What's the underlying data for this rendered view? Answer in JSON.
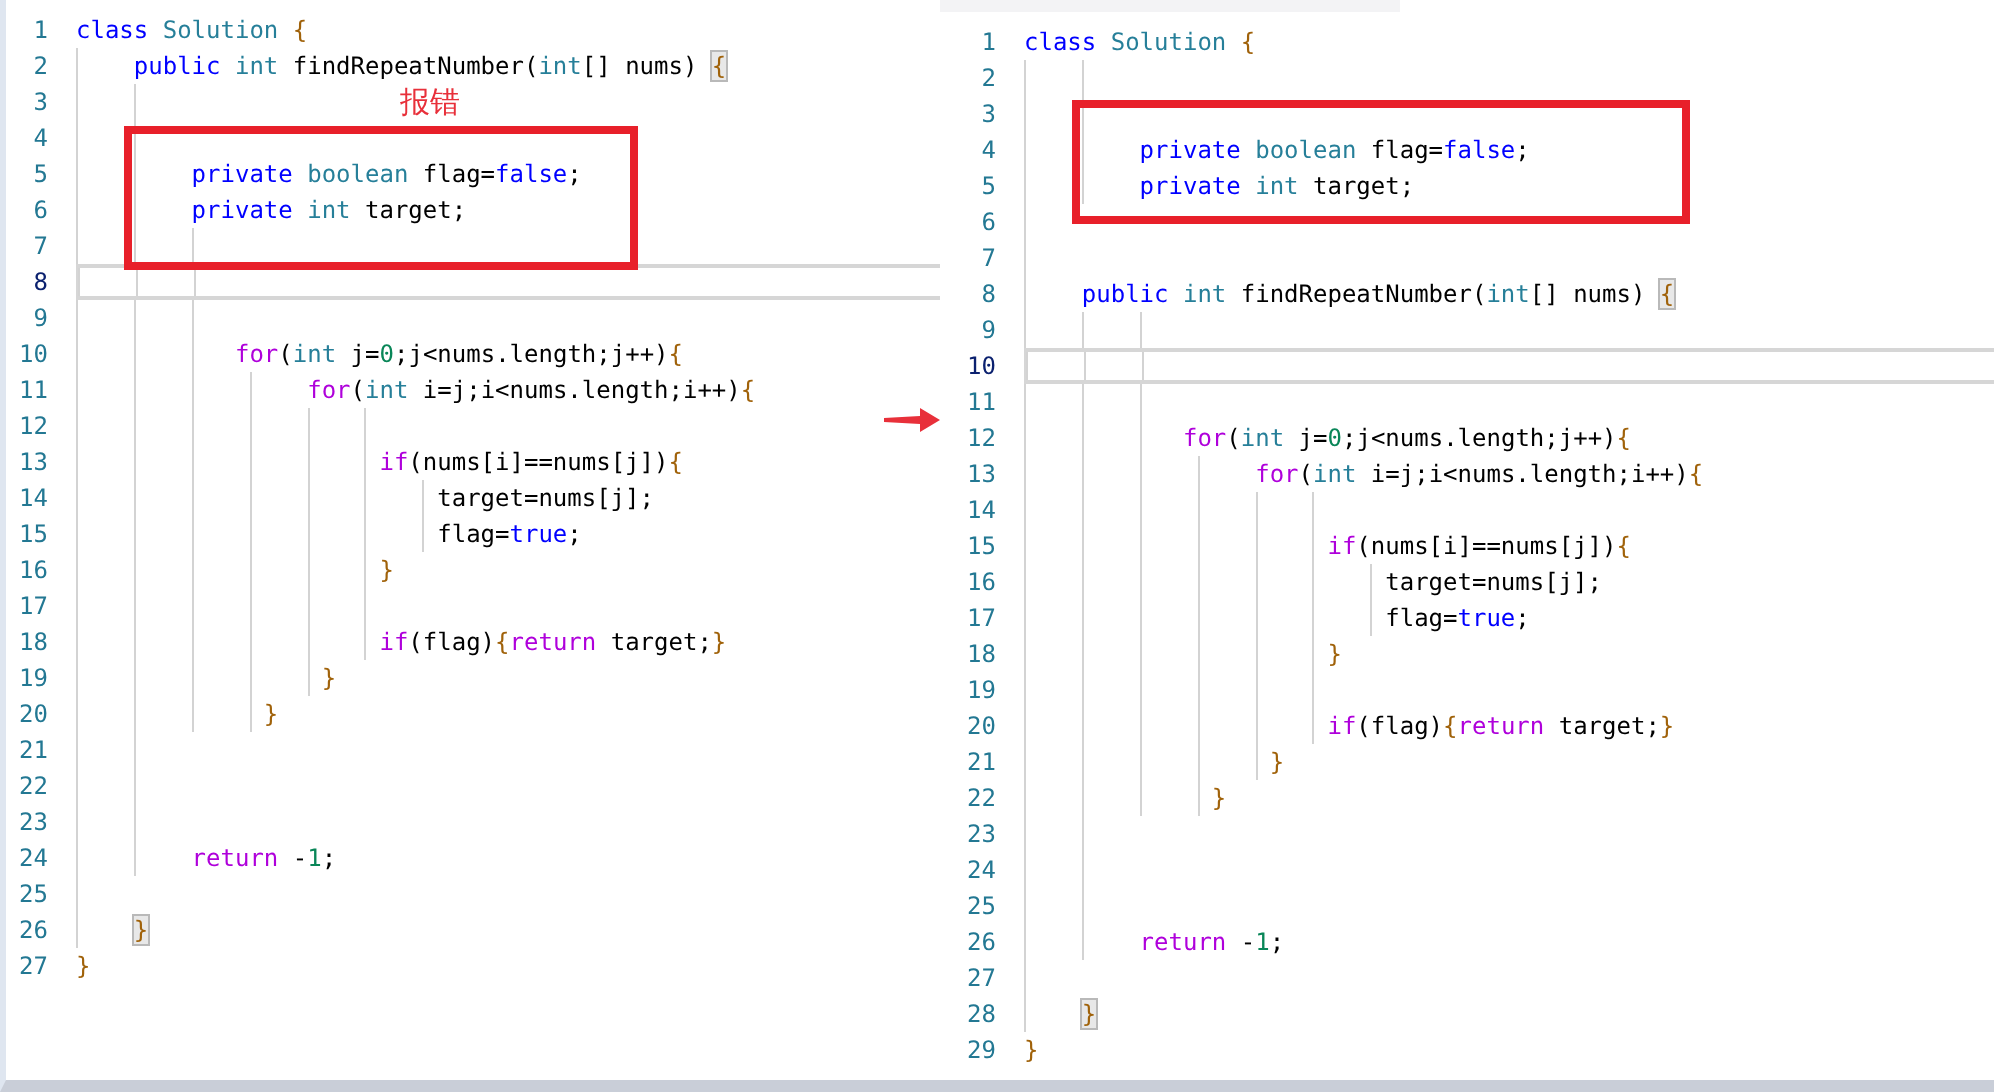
{
  "panes": [
    {
      "box_label": "报错",
      "lines": [
        {
          "number": "1",
          "current": false,
          "boxed": false,
          "tokens": [
            {
              "kind": "kw",
              "text": "class"
            },
            {
              "kind": "type",
              "text": " Solution"
            },
            {
              "kind": "brace",
              "text": " {"
            }
          ]
        },
        {
          "number": "2",
          "current": false,
          "boxed": false,
          "tokens": [
            {
              "kind": "kw",
              "text": "    public"
            },
            {
              "kind": "type",
              "text": " int"
            },
            {
              "kind": "txt",
              "text": " findRepeatNumber("
            },
            {
              "kind": "type",
              "text": "int"
            },
            {
              "kind": "txt",
              "text": "[] nums) "
            },
            {
              "kind": "match",
              "text": "{"
            }
          ]
        },
        {
          "number": "3",
          "current": false,
          "boxed": false
        },
        {
          "number": "4",
          "current": false,
          "boxed": true
        },
        {
          "number": "5",
          "current": false,
          "boxed": true,
          "tokens": [
            {
              "kind": "kw",
              "text": "        private"
            },
            {
              "kind": "type",
              "text": " boolean"
            },
            {
              "kind": "txt",
              "text": " flag="
            },
            {
              "kind": "kw",
              "text": "false"
            },
            {
              "kind": "txt",
              "text": ";"
            }
          ]
        },
        {
          "number": "6",
          "current": false,
          "boxed": true,
          "tokens": [
            {
              "kind": "kw",
              "text": "        private"
            },
            {
              "kind": "type",
              "text": " int"
            },
            {
              "kind": "txt",
              "text": " target;"
            }
          ]
        },
        {
          "number": "7",
          "current": false,
          "boxed": true
        },
        {
          "number": "8",
          "current": true,
          "boxed": false
        },
        {
          "number": "9",
          "current": false,
          "boxed": false
        },
        {
          "number": "10",
          "current": false,
          "boxed": false,
          "tokens": [
            {
              "kind": "ctl",
              "text": "           for"
            },
            {
              "kind": "txt",
              "text": "("
            },
            {
              "kind": "type",
              "text": "int"
            },
            {
              "kind": "txt",
              "text": " j="
            },
            {
              "kind": "num",
              "text": "0"
            },
            {
              "kind": "txt",
              "text": ";j<nums.length;j++)"
            },
            {
              "kind": "brace",
              "text": "{"
            }
          ]
        },
        {
          "number": "11",
          "current": false,
          "boxed": false,
          "tokens": [
            {
              "kind": "ctl",
              "text": "                for"
            },
            {
              "kind": "txt",
              "text": "("
            },
            {
              "kind": "type",
              "text": "int"
            },
            {
              "kind": "txt",
              "text": " i=j;i<nums.length;i++)"
            },
            {
              "kind": "brace",
              "text": "{"
            }
          ]
        },
        {
          "number": "12",
          "current": false,
          "boxed": false
        },
        {
          "number": "13",
          "current": false,
          "boxed": false,
          "tokens": [
            {
              "kind": "ctl",
              "text": "                     if"
            },
            {
              "kind": "txt",
              "text": "(nums[i]==nums[j])"
            },
            {
              "kind": "brace",
              "text": "{"
            }
          ]
        },
        {
          "number": "14",
          "current": false,
          "boxed": false,
          "tokens": [
            {
              "kind": "txt",
              "text": "                         target=nums[j];"
            }
          ]
        },
        {
          "number": "15",
          "current": false,
          "boxed": false,
          "tokens": [
            {
              "kind": "txt",
              "text": "                         flag="
            },
            {
              "kind": "kw",
              "text": "true"
            },
            {
              "kind": "txt",
              "text": ";"
            }
          ]
        },
        {
          "number": "16",
          "current": false,
          "boxed": false,
          "tokens": [
            {
              "kind": "brace",
              "text": "                     }"
            }
          ]
        },
        {
          "number": "17",
          "current": false,
          "boxed": false
        },
        {
          "number": "18",
          "current": false,
          "boxed": false,
          "tokens": [
            {
              "kind": "ctl",
              "text": "                     if"
            },
            {
              "kind": "txt",
              "text": "(flag)"
            },
            {
              "kind": "brace",
              "text": "{"
            },
            {
              "kind": "ctl",
              "text": "return"
            },
            {
              "kind": "txt",
              "text": " target;"
            },
            {
              "kind": "brace",
              "text": "}"
            }
          ]
        },
        {
          "number": "19",
          "current": false,
          "boxed": false,
          "tokens": [
            {
              "kind": "brace",
              "text": "                 }"
            }
          ]
        },
        {
          "number": "20",
          "current": false,
          "boxed": false,
          "tokens": [
            {
              "kind": "brace",
              "text": "             }"
            }
          ]
        },
        {
          "number": "21",
          "current": false,
          "boxed": false
        },
        {
          "number": "22",
          "current": false,
          "boxed": false
        },
        {
          "number": "23",
          "current": false,
          "boxed": false
        },
        {
          "number": "24",
          "current": false,
          "boxed": false,
          "tokens": [
            {
              "kind": "ctl",
              "text": "        return"
            },
            {
              "kind": "txt",
              "text": " -"
            },
            {
              "kind": "num",
              "text": "1"
            },
            {
              "kind": "txt",
              "text": ";"
            }
          ]
        },
        {
          "number": "25",
          "current": false,
          "boxed": false
        },
        {
          "number": "26",
          "current": false,
          "boxed": false,
          "tokens": [
            {
              "kind": "match",
              "text": "    }"
            }
          ]
        },
        {
          "number": "27",
          "current": false,
          "boxed": false,
          "tokens": [
            {
              "kind": "brace",
              "text": "}"
            }
          ]
        }
      ]
    },
    {
      "lines": [
        {
          "number": "1",
          "current": false,
          "boxed": false,
          "tokens": [
            {
              "kind": "kw",
              "text": "class"
            },
            {
              "kind": "type",
              "text": " Solution"
            },
            {
              "kind": "brace",
              "text": " {"
            }
          ]
        },
        {
          "number": "2",
          "current": false,
          "boxed": false
        },
        {
          "number": "3",
          "current": false,
          "boxed": true
        },
        {
          "number": "4",
          "current": false,
          "boxed": true,
          "tokens": [
            {
              "kind": "kw",
              "text": "        private"
            },
            {
              "kind": "type",
              "text": " boolean"
            },
            {
              "kind": "txt",
              "text": " flag="
            },
            {
              "kind": "kw",
              "text": "false"
            },
            {
              "kind": "txt",
              "text": ";"
            }
          ]
        },
        {
          "number": "5",
          "current": false,
          "boxed": true,
          "tokens": [
            {
              "kind": "kw",
              "text": "        private"
            },
            {
              "kind": "type",
              "text": " int"
            },
            {
              "kind": "txt",
              "text": " target;"
            }
          ]
        },
        {
          "number": "6",
          "current": false,
          "boxed": true
        },
        {
          "number": "7",
          "current": false,
          "boxed": false
        },
        {
          "number": "8",
          "current": false,
          "boxed": false,
          "tokens": [
            {
              "kind": "kw",
              "text": "    public"
            },
            {
              "kind": "type",
              "text": " int"
            },
            {
              "kind": "txt",
              "text": " findRepeatNumber("
            },
            {
              "kind": "type",
              "text": "int"
            },
            {
              "kind": "txt",
              "text": "[] nums) "
            },
            {
              "kind": "match",
              "text": "{"
            }
          ]
        },
        {
          "number": "9",
          "current": false,
          "boxed": false
        },
        {
          "number": "10",
          "current": true,
          "boxed": false
        },
        {
          "number": "11",
          "current": false,
          "boxed": false
        },
        {
          "number": "12",
          "current": false,
          "boxed": false,
          "tokens": [
            {
              "kind": "ctl",
              "text": "           for"
            },
            {
              "kind": "txt",
              "text": "("
            },
            {
              "kind": "type",
              "text": "int"
            },
            {
              "kind": "txt",
              "text": " j="
            },
            {
              "kind": "num",
              "text": "0"
            },
            {
              "kind": "txt",
              "text": ";j<nums.length;j++)"
            },
            {
              "kind": "brace",
              "text": "{"
            }
          ]
        },
        {
          "number": "13",
          "current": false,
          "boxed": false,
          "tokens": [
            {
              "kind": "ctl",
              "text": "                for"
            },
            {
              "kind": "txt",
              "text": "("
            },
            {
              "kind": "type",
              "text": "int"
            },
            {
              "kind": "txt",
              "text": " i=j;i<nums.length;i++)"
            },
            {
              "kind": "brace",
              "text": "{"
            }
          ]
        },
        {
          "number": "14",
          "current": false,
          "boxed": false
        },
        {
          "number": "15",
          "current": false,
          "boxed": false,
          "tokens": [
            {
              "kind": "ctl",
              "text": "                     if"
            },
            {
              "kind": "txt",
              "text": "(nums[i]==nums[j])"
            },
            {
              "kind": "brace",
              "text": "{"
            }
          ]
        },
        {
          "number": "16",
          "current": false,
          "boxed": false,
          "tokens": [
            {
              "kind": "txt",
              "text": "                         target=nums[j];"
            }
          ]
        },
        {
          "number": "17",
          "current": false,
          "boxed": false,
          "tokens": [
            {
              "kind": "txt",
              "text": "                         flag="
            },
            {
              "kind": "kw",
              "text": "true"
            },
            {
              "kind": "txt",
              "text": ";"
            }
          ]
        },
        {
          "number": "18",
          "current": false,
          "boxed": false,
          "tokens": [
            {
              "kind": "brace",
              "text": "                     }"
            }
          ]
        },
        {
          "number": "19",
          "current": false,
          "boxed": false
        },
        {
          "number": "20",
          "current": false,
          "boxed": false,
          "tokens": [
            {
              "kind": "ctl",
              "text": "                     if"
            },
            {
              "kind": "txt",
              "text": "(flag)"
            },
            {
              "kind": "brace",
              "text": "{"
            },
            {
              "kind": "ctl",
              "text": "return"
            },
            {
              "kind": "txt",
              "text": " target;"
            },
            {
              "kind": "brace",
              "text": "}"
            }
          ]
        },
        {
          "number": "21",
          "current": false,
          "boxed": false,
          "tokens": [
            {
              "kind": "brace",
              "text": "                 }"
            }
          ]
        },
        {
          "number": "22",
          "current": false,
          "boxed": false,
          "tokens": [
            {
              "kind": "brace",
              "text": "             }"
            }
          ]
        },
        {
          "number": "23",
          "current": false,
          "boxed": false
        },
        {
          "number": "24",
          "current": false,
          "boxed": false
        },
        {
          "number": "25",
          "current": false,
          "boxed": false
        },
        {
          "number": "26",
          "current": false,
          "boxed": false,
          "tokens": [
            {
              "kind": "ctl",
              "text": "        return"
            },
            {
              "kind": "txt",
              "text": " -"
            },
            {
              "kind": "num",
              "text": "1"
            },
            {
              "kind": "txt",
              "text": ";"
            }
          ]
        },
        {
          "number": "27",
          "current": false,
          "boxed": false
        },
        {
          "number": "28",
          "current": false,
          "boxed": false,
          "tokens": [
            {
              "kind": "match",
              "text": "    }"
            }
          ]
        },
        {
          "number": "29",
          "current": false,
          "boxed": false,
          "tokens": [
            {
              "kind": "brace",
              "text": "}"
            }
          ]
        }
      ]
    }
  ]
}
